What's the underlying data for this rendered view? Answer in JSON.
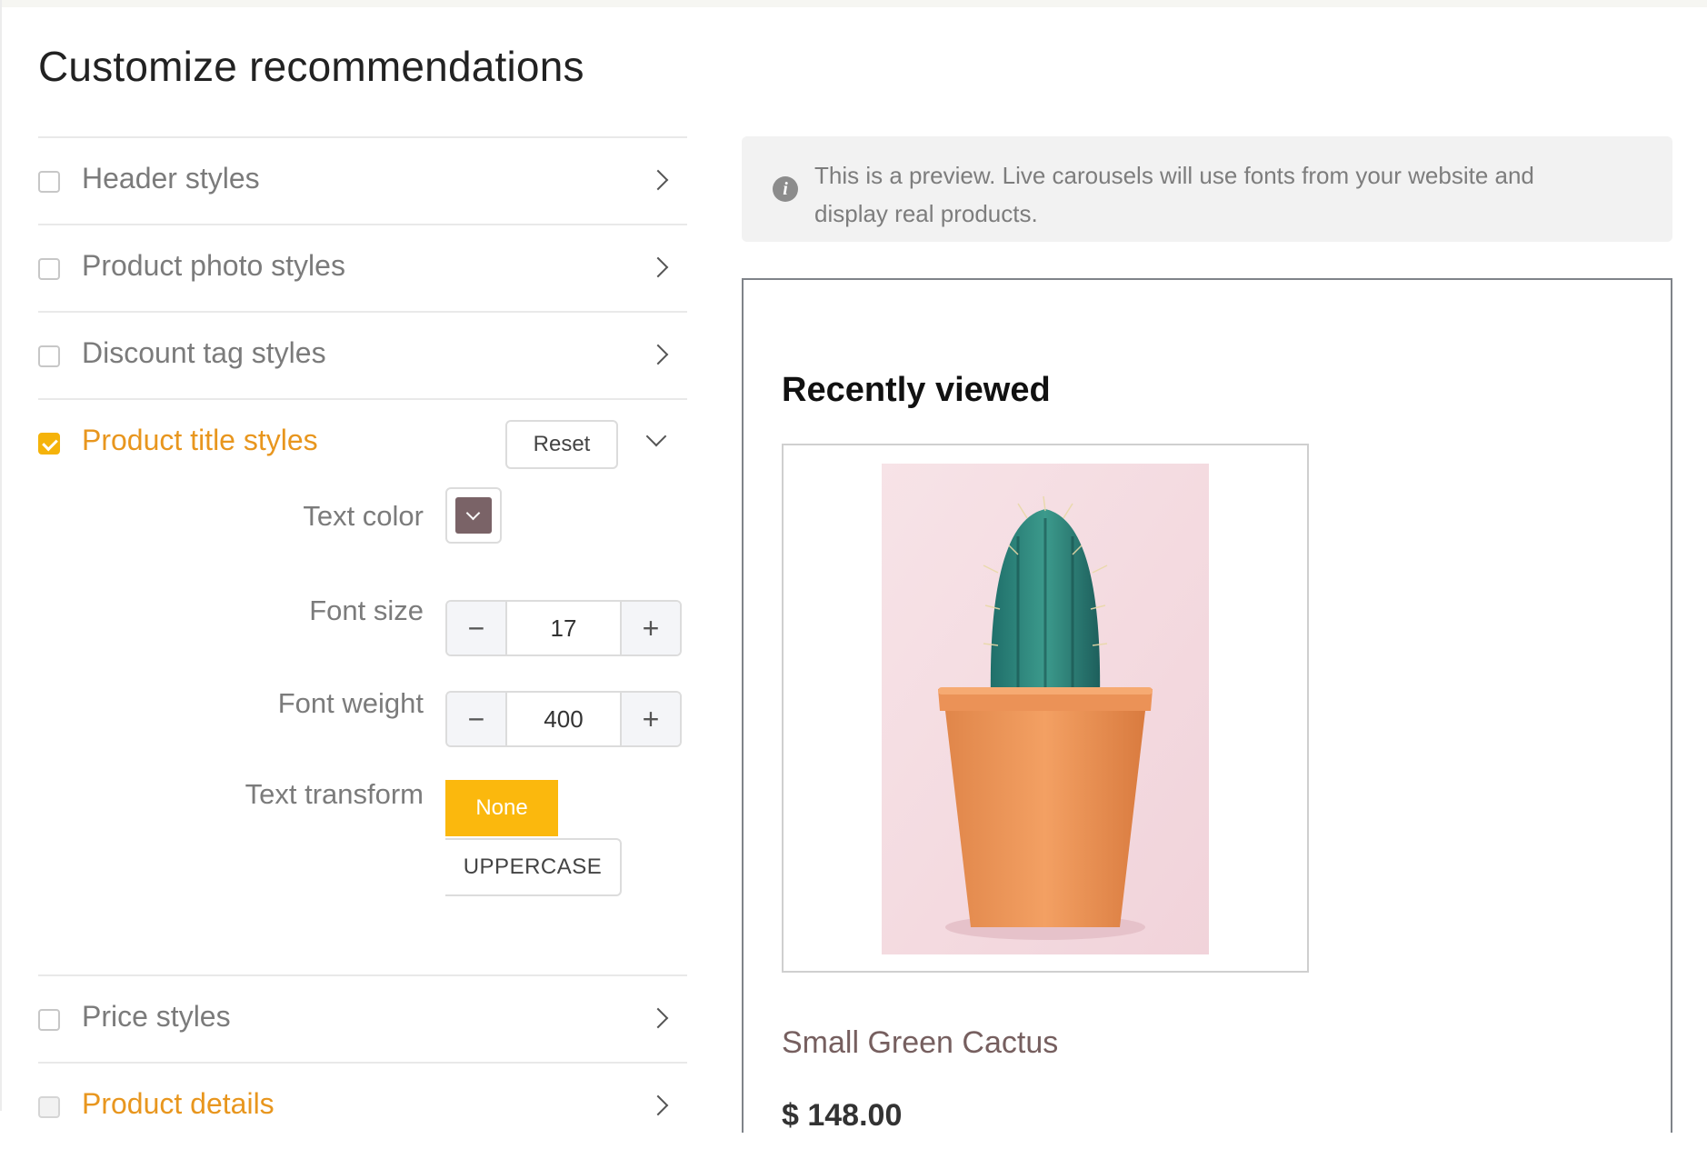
{
  "page": {
    "title": "Customize recommendations"
  },
  "sections": [
    {
      "label": "Header styles",
      "checked": false,
      "expanded": false
    },
    {
      "label": "Product photo styles",
      "checked": false,
      "expanded": false
    },
    {
      "label": "Discount tag styles",
      "checked": false,
      "expanded": false
    },
    {
      "label": "Product title styles",
      "checked": true,
      "expanded": true,
      "reset_label": "Reset"
    },
    {
      "label": "Price styles",
      "checked": false,
      "expanded": false
    },
    {
      "label": "Product details",
      "checked": true,
      "expanded": false
    }
  ],
  "title_settings": {
    "text_color": {
      "label": "Text color",
      "value": "#7a6367"
    },
    "font_size": {
      "label": "Font size",
      "value": "17",
      "minus": "−",
      "plus": "+"
    },
    "font_weight": {
      "label": "Font weight",
      "value": "400",
      "minus": "−",
      "plus": "+"
    },
    "text_transform": {
      "label": "Text transform",
      "options": [
        "None",
        "UPPERCASE"
      ],
      "selected": "None"
    }
  },
  "notice": {
    "text": "This is a preview. Live carousels will use fonts from your website and display real products."
  },
  "preview": {
    "heading": "Recently viewed",
    "product": {
      "title": "Small Green Cactus",
      "price": "$ 148.00"
    }
  },
  "colors": {
    "accent": "#f5b30a",
    "active_label": "#e8961e",
    "title_color": "#765f5f"
  }
}
